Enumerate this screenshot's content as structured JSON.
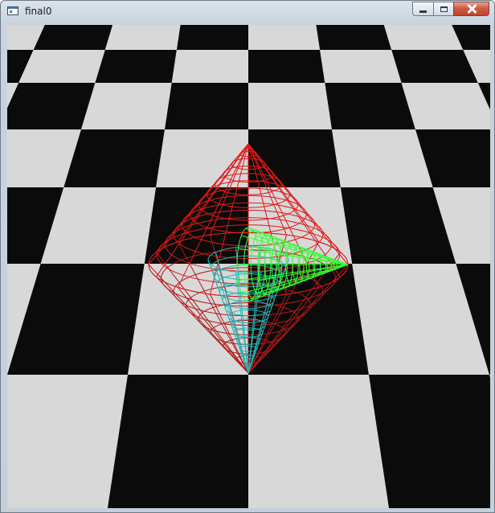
{
  "window": {
    "title": "final0",
    "buttons": {
      "minimize": "minimize",
      "maximize": "maximize",
      "close": "close"
    }
  },
  "scene": {
    "background_color": "#d9d9d9",
    "floor": {
      "light_color": "#d8d8d8",
      "dark_color": "#0b0b0b"
    },
    "objects": [
      {
        "name": "upper-cone",
        "color": "#e01818"
      },
      {
        "name": "lower-cone",
        "color": "#b01818"
      },
      {
        "name": "green-cone",
        "color": "#33ff33"
      },
      {
        "name": "cyan-cone",
        "color": "#1fb5b5"
      }
    ]
  },
  "icons": [
    "app-icon",
    "minimize-icon",
    "maximize-icon",
    "close-icon"
  ]
}
